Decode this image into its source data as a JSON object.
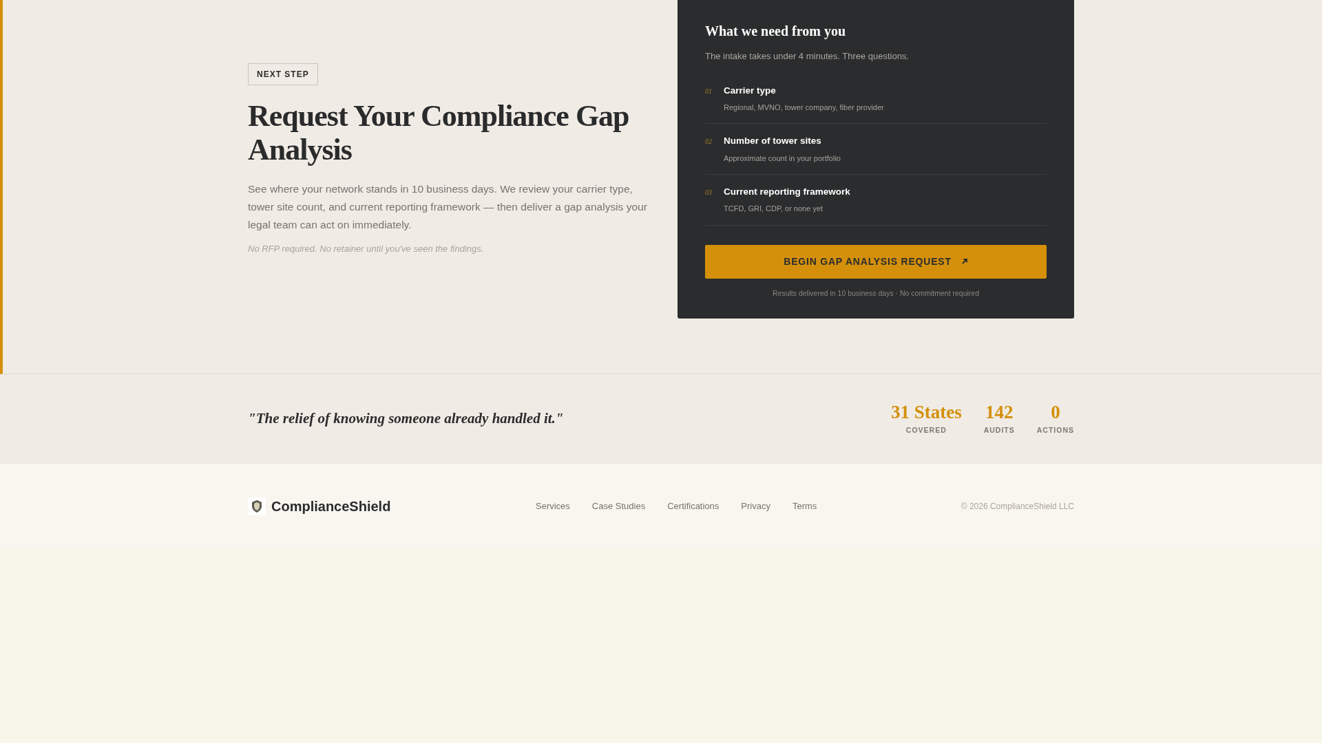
{
  "hero": {
    "badge": "NEXT STEP",
    "title": "Request Your Compliance Gap Analysis",
    "description": "See where your network stands in 10 business days. We review your carrier type, tower site count, and current reporting framework — then deliver a gap analysis your legal team can act on immediately.",
    "note": "No RFP required. No retainer until you've seen the findings."
  },
  "card": {
    "title": "What we need from you",
    "subtitle": "The intake takes under 4 minutes. Three questions.",
    "questions": [
      {
        "number": "01",
        "label": "Carrier type",
        "hint": "Regional, MVNO, tower company, fiber provider"
      },
      {
        "number": "02",
        "label": "Number of tower sites",
        "hint": "Approximate count in your portfolio"
      },
      {
        "number": "03",
        "label": "Current reporting framework",
        "hint": "TCFD, GRI, CDP, or none yet"
      }
    ],
    "button": "BEGIN GAP ANALYSIS REQUEST",
    "footnote": "Results delivered in 10 business days · No commitment required"
  },
  "band": {
    "quote": "\"The relief of knowing someone already handled it.\"",
    "stats": [
      {
        "value": "31 States",
        "label": "COVERED"
      },
      {
        "value": "142",
        "label": "AUDITS"
      },
      {
        "value": "0",
        "label": "ACTIONS"
      }
    ]
  },
  "footer": {
    "brand": "ComplianceShield",
    "links": [
      "Services",
      "Case Studies",
      "Certifications",
      "Privacy",
      "Terms"
    ],
    "copyright": "© 2026 ComplianceShield LLC"
  }
}
